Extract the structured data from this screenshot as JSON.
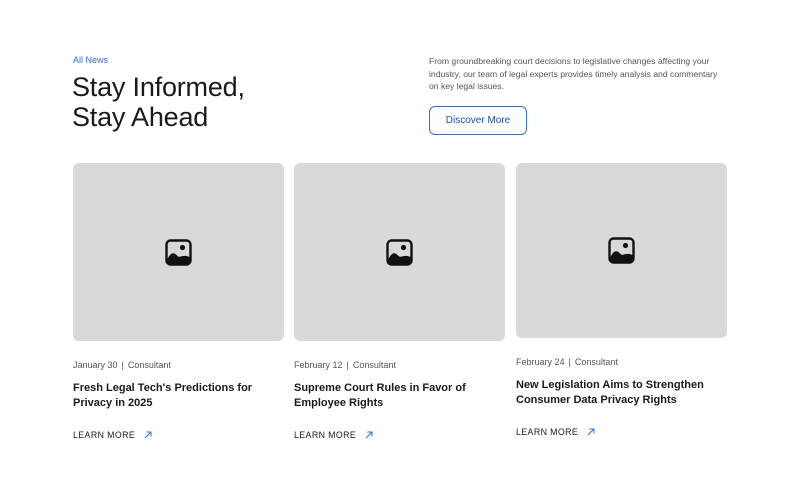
{
  "header": {
    "eyebrow": "All News",
    "headline_line1": "Stay Informed,",
    "headline_line2": "Stay Ahead",
    "intro": "From groundbreaking court decisions to legislative changes affecting your industry, our team of legal experts provides timely analysis and commentary on key legal issues.",
    "discover_label": "Discover More"
  },
  "cards": [
    {
      "date": "January 30",
      "category": "Consultant",
      "title": "Fresh Legal Tech's Predictions for Privacy in 2025",
      "link_label": "LEARN MORE",
      "image_icon": "image-placeholder-icon"
    },
    {
      "date": "February 12",
      "category": "Consultant",
      "title": "Supreme Court Rules in Favor of Employee Rights",
      "link_label": "LEARN MORE",
      "image_icon": "image-placeholder-icon"
    },
    {
      "date": "February 24",
      "category": "Consultant",
      "title": "New Legislation Aims to Strengthen Consumer Data Privacy Rights",
      "link_label": "LEARN MORE",
      "image_icon": "image-placeholder-icon"
    }
  ],
  "colors": {
    "accent": "#2f6fd6",
    "placeholder": "#d9d9d9",
    "text": "#1a1a1a"
  },
  "icons": {
    "card_image": "image-placeholder-icon",
    "link_arrow": "arrow-up-right-icon"
  }
}
